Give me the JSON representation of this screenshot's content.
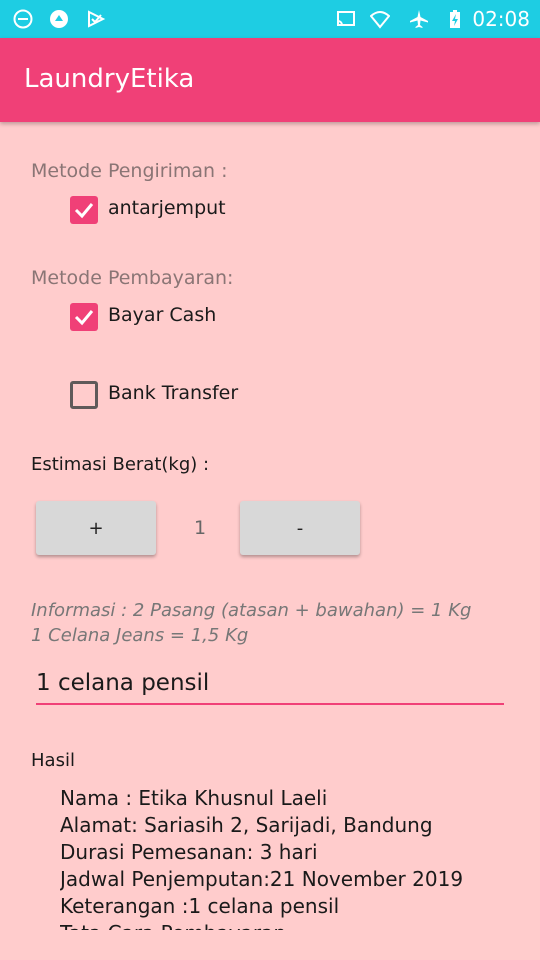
{
  "status_bar": {
    "time": "02:08",
    "left_icons": [
      "do-not-disturb-icon",
      "app-notification-icon",
      "download-done-icon"
    ],
    "right_icons": [
      "cast-icon",
      "wifi-icon",
      "airplane-mode-icon",
      "battery-charging-icon"
    ]
  },
  "app_bar": {
    "title": "LaundryEtika"
  },
  "delivery": {
    "label": "Metode Pengiriman :",
    "options": [
      {
        "label": "antarjemput",
        "checked": true
      }
    ]
  },
  "payment": {
    "label": "Metode Pembayaran:",
    "options": [
      {
        "label": "Bayar Cash",
        "checked": true
      },
      {
        "label": "Bank Transfer",
        "checked": false
      }
    ]
  },
  "weight": {
    "label": "Estimasi Berat(kg) :",
    "plus_label": "+",
    "minus_label": "-",
    "value": "1"
  },
  "info": {
    "line1": "Informasi : 2 Pasang (atasan + bawahan) = 1 Kg",
    "line2": "1 Celana Jeans = 1,5 Kg"
  },
  "note": {
    "value": "1 celana pensil"
  },
  "result": {
    "label": "Hasil",
    "lines": [
      "Nama : Etika Khusnul Laeli",
      "Alamat: Sariasih 2, Sarijadi, Bandung",
      "Durasi Pemesanan: 3 hari",
      "Jadwal Penjemputan:21 November 2019",
      "Keterangan :1 celana pensil",
      "Tata Cara Pembayaran"
    ]
  },
  "colors": {
    "status_bar": "#1ecde3",
    "app_bar": "#f04077",
    "background": "#ffcccc",
    "accent": "#f04077"
  }
}
